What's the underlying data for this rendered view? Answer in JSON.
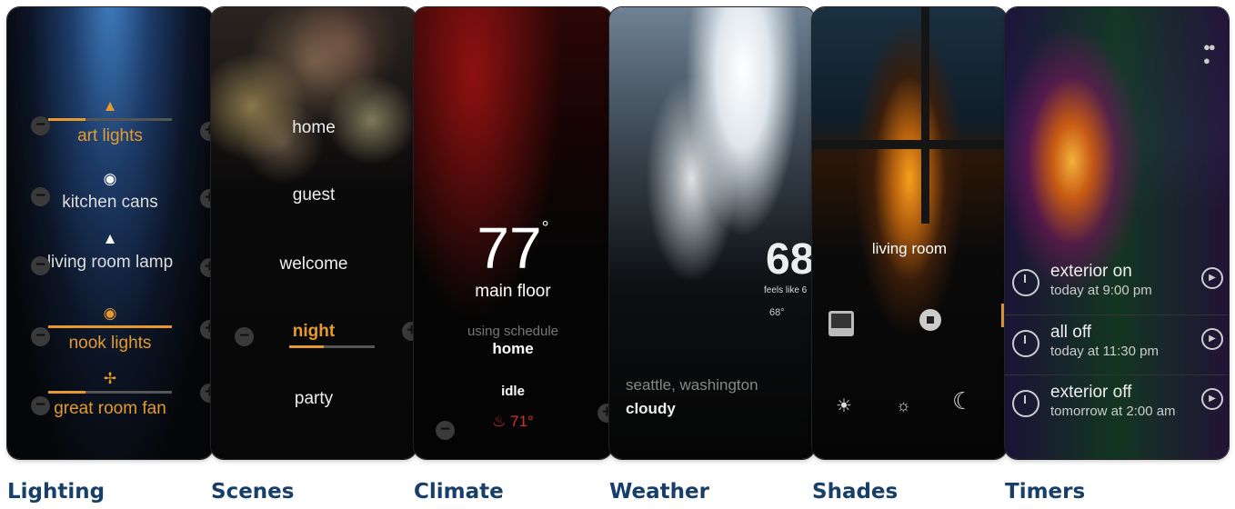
{
  "lighting": {
    "items": [
      {
        "label": "art lights",
        "icon": "spotlight-icon",
        "level": 0.55,
        "on": true
      },
      {
        "label": "kitchen cans",
        "icon": "recessed-light-icon",
        "level": 0,
        "on": false
      },
      {
        "label": "living room lamp",
        "icon": "lamp-icon",
        "level": 0,
        "on": false
      },
      {
        "label": "nook lights",
        "icon": "pendant-light-icon",
        "level": 1.0,
        "on": true
      },
      {
        "label": "great room fan",
        "icon": "ceiling-fan-icon",
        "level": 0.3,
        "on": true
      }
    ]
  },
  "scenes": {
    "items": [
      {
        "label": "home",
        "active": false
      },
      {
        "label": "guest",
        "active": false
      },
      {
        "label": "welcome",
        "active": false
      },
      {
        "label": "night",
        "active": true,
        "level": 0.4
      },
      {
        "label": "party",
        "active": false
      }
    ]
  },
  "climate": {
    "temperature": "77",
    "degree": "°",
    "zone": "main floor",
    "schedule_prefix": "using schedule",
    "schedule_name": "home",
    "status": "idle",
    "heat_setpoint": "71°"
  },
  "weather": {
    "temperature": "68",
    "feels_like": "feels like 6",
    "low": "68°",
    "location": "seattle, washington",
    "condition": "cloudy"
  },
  "shades": {
    "room": "living room"
  },
  "timers": {
    "items": [
      {
        "title": "exterior on",
        "subtitle": "today at 9:00 pm"
      },
      {
        "title": "all off",
        "subtitle": "today at 11:30 pm"
      },
      {
        "title": "exterior off",
        "subtitle": "tomorrow at 2:00 am"
      }
    ]
  },
  "captions": {
    "lighting": "Lighting",
    "scenes": "Scenes",
    "climate": "Climate",
    "weather": "Weather",
    "shades": "Shades",
    "timers": "Timers"
  },
  "colors": {
    "accent": "#e69a2e",
    "caption": "#173f6a",
    "heat": "#d33030"
  }
}
